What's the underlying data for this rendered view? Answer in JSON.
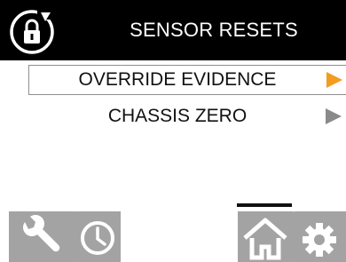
{
  "header": {
    "title": "SENSOR RESETS",
    "lock_icon": "rotating-padlock-icon"
  },
  "menu": {
    "items": [
      {
        "label": "OVERRIDE EVIDENCE",
        "selected": true,
        "arrow_color": "#f39c1f"
      },
      {
        "label": "CHASSIS ZERO",
        "selected": false,
        "arrow_color": "#8a8a8a"
      }
    ]
  },
  "footer": {
    "active_tab": "home",
    "icons": [
      "wrench-icon",
      "clock-icon",
      "home-icon",
      "gear-icon"
    ]
  },
  "colors": {
    "header_bg": "#000000",
    "header_text": "#ffffff",
    "accent": "#f39c1f",
    "icon_gray": "#9b9b9b"
  }
}
